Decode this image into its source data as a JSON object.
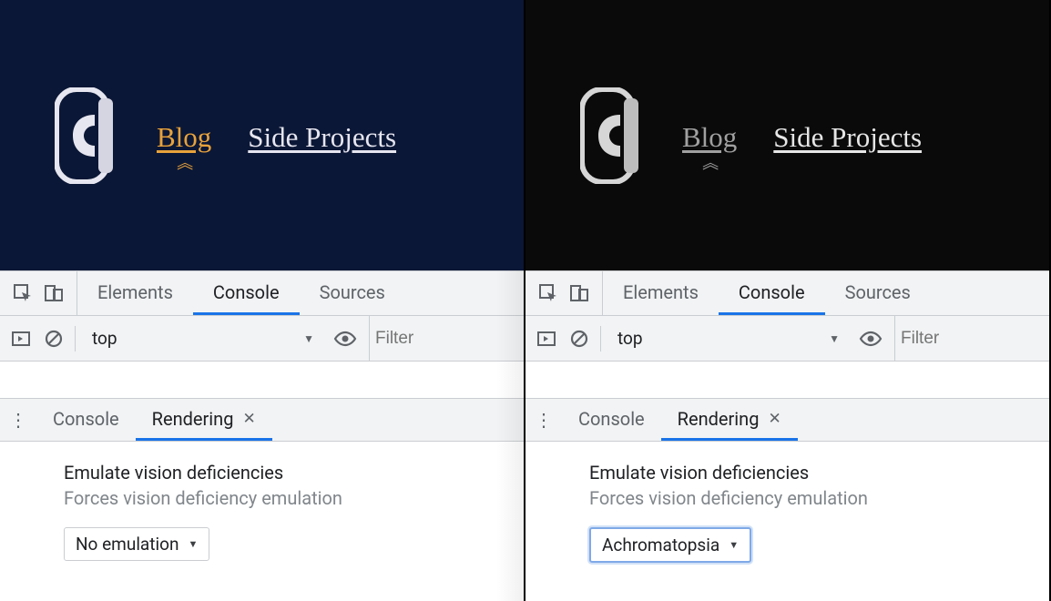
{
  "panes": [
    {
      "id": "left",
      "preview": {
        "background": "#0b1736",
        "nav": [
          {
            "label": "Blog",
            "active": true,
            "color": "#e8a23b"
          },
          {
            "label": "Side Projects",
            "active": false,
            "color": "#e6e6f0"
          }
        ]
      },
      "devtools": {
        "tabs": [
          "Elements",
          "Console",
          "Sources"
        ],
        "active_tab": "Console",
        "context": "top",
        "filter_placeholder": "Filter",
        "drawer_tabs": [
          "Console",
          "Rendering"
        ],
        "drawer_active": "Rendering",
        "panel_title": "Emulate vision deficiencies",
        "panel_subtitle": "Forces vision deficiency emulation",
        "select_value": "No emulation",
        "select_focused": false
      }
    },
    {
      "id": "right",
      "preview": {
        "background": "#0a0a0a",
        "nav": [
          {
            "label": "Blog",
            "active": true,
            "color": "#a0a0a0"
          },
          {
            "label": "Side Projects",
            "active": false,
            "color": "#e6e6e6"
          }
        ]
      },
      "devtools": {
        "tabs": [
          "Elements",
          "Console",
          "Sources"
        ],
        "active_tab": "Console",
        "context": "top",
        "filter_placeholder": "Filter",
        "drawer_tabs": [
          "Console",
          "Rendering"
        ],
        "drawer_active": "Rendering",
        "panel_title": "Emulate vision deficiencies",
        "panel_subtitle": "Forces vision deficiency emulation",
        "select_value": "Achromatopsia",
        "select_focused": true
      }
    }
  ]
}
